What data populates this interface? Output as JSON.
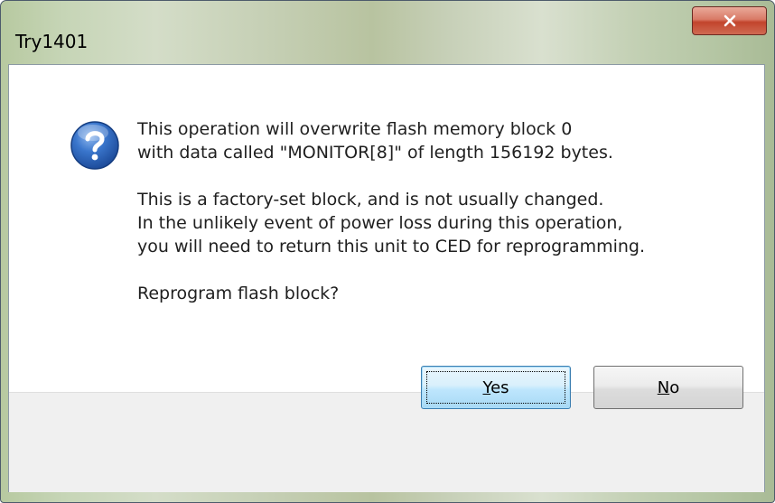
{
  "window": {
    "title": "Try1401"
  },
  "message": {
    "icon": "question-icon",
    "line1": "This operation will overwrite flash memory block 0",
    "line2": "with data called \"MONITOR[8]\" of length 156192 bytes.",
    "line3": "This is a factory-set block, and is not usually changed.",
    "line4": "In the unlikely event of power loss during this operation,",
    "line5": "you will need to return this unit to CED for reprogramming.",
    "line6": "Reprogram flash block?"
  },
  "buttons": {
    "yes_accel": "Y",
    "yes_rest": "es",
    "no_accel": "N",
    "no_rest": "o"
  },
  "colors": {
    "question_icon": "#2a64b9",
    "close_button": "#c2442c"
  }
}
